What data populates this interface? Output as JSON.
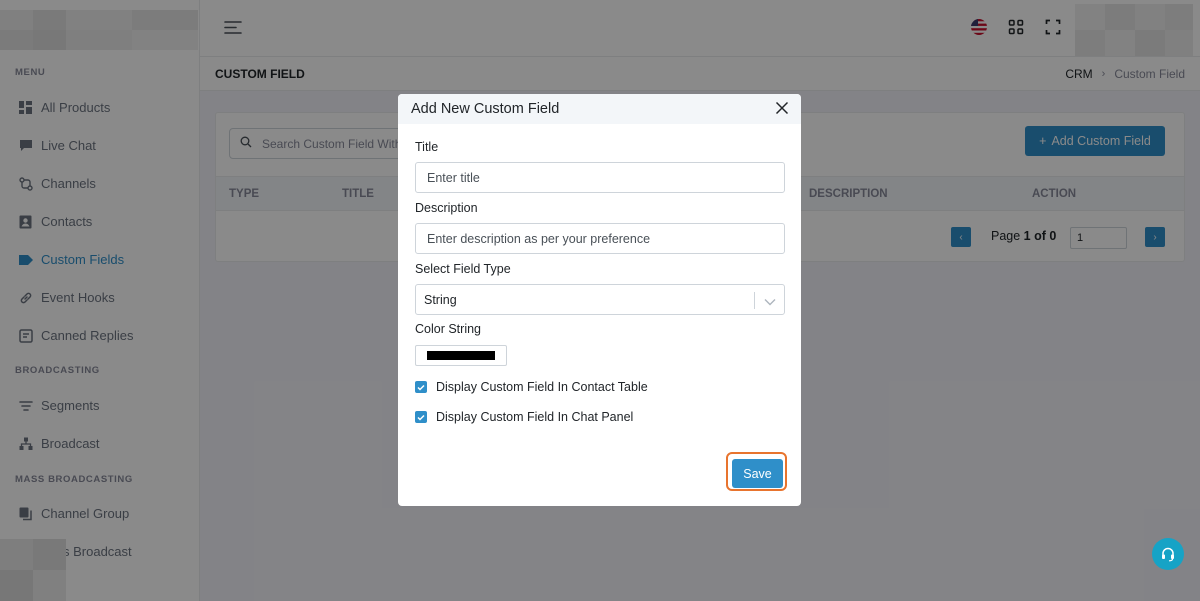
{
  "sidebar": {
    "sections": [
      {
        "title": "MENU"
      },
      {
        "title": "BROADCASTING"
      },
      {
        "title": "MASS BROADCASTING"
      }
    ],
    "items": [
      {
        "label": "All Products",
        "icon": "grid-icon"
      },
      {
        "label": "Live Chat",
        "icon": "chat-icon"
      },
      {
        "label": "Channels",
        "icon": "channels-icon"
      },
      {
        "label": "Contacts",
        "icon": "contact-card-icon"
      },
      {
        "label": "Custom Fields",
        "icon": "tag-icon",
        "active": true
      },
      {
        "label": "Event Hooks",
        "icon": "link-icon"
      },
      {
        "label": "Canned Replies",
        "icon": "reply-icon"
      },
      {
        "label": "Segments",
        "icon": "filter-icon"
      },
      {
        "label": "Broadcast",
        "icon": "broadcast-icon"
      },
      {
        "label": "Channel Group",
        "icon": "copy-icon"
      },
      {
        "label": "s Broadcast",
        "icon": "broadcast-icon"
      }
    ]
  },
  "topbar": {
    "icons": [
      "menu-icon",
      "us-flag-icon",
      "apps-grid-icon",
      "fullscreen-icon"
    ]
  },
  "page": {
    "title": "CUSTOM FIELD",
    "breadcrumb": [
      "CRM",
      "Custom Field"
    ]
  },
  "card": {
    "search_placeholder": "Search Custom Field With title",
    "add_button": "Add Custom Field",
    "columns": [
      "TYPE",
      "TITLE",
      "DESCRIPTION",
      "ACTION"
    ],
    "pagination": {
      "prefix": "Page ",
      "current": "1",
      "of": " of ",
      "total": "0",
      "input_value": "1"
    }
  },
  "modal": {
    "title": "Add New Custom Field",
    "title_label": "Title",
    "title_placeholder": "Enter title",
    "description_label": "Description",
    "description_placeholder": "Enter description as per your preference",
    "type_label": "Select Field Type",
    "type_value": "String",
    "color_label": "Color String",
    "color_value": "#000000",
    "checkbox_contact": "Display Custom Field In Contact Table",
    "checkbox_chat": "Display Custom Field In Chat Panel",
    "save": "Save"
  },
  "colors": {
    "accent": "#2f8fc9",
    "highlight_ring": "#e8742e",
    "help": "#16a3c6"
  }
}
